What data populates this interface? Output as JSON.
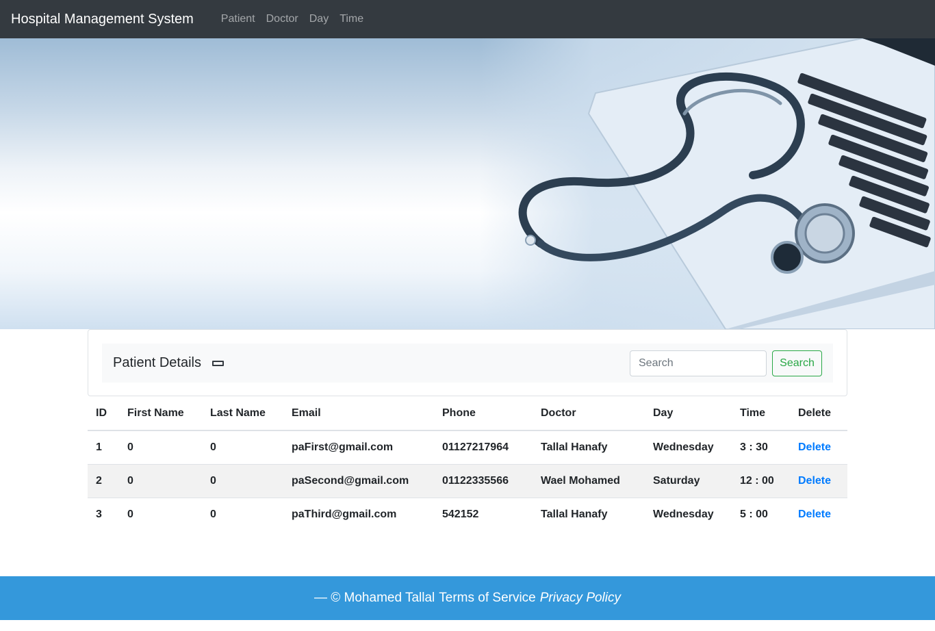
{
  "navbar": {
    "brand": "Hospital Management System",
    "links": [
      "Patient",
      "Doctor",
      "Day",
      "Time"
    ]
  },
  "card": {
    "title": "Patient Details",
    "search_placeholder": "Search",
    "search_button": "Search"
  },
  "table": {
    "headers": [
      "ID",
      "First Name",
      "Last Name",
      "Email",
      "Phone",
      "Doctor",
      "Day",
      "Time",
      "Delete"
    ],
    "rows": [
      {
        "id": "1",
        "first": "0",
        "last": "0",
        "email": "paFirst@gmail.com",
        "phone": "01127217964",
        "doctor": "Tallal Hanafy",
        "day": "Wednesday",
        "time": "3 : 30",
        "action": "Delete"
      },
      {
        "id": "2",
        "first": "0",
        "last": "0",
        "email": "paSecond@gmail.com",
        "phone": "01122335566",
        "doctor": "Wael Mohamed",
        "day": "Saturday",
        "time": "12 : 00",
        "action": "Delete"
      },
      {
        "id": "3",
        "first": "0",
        "last": "0",
        "email": "paThird@gmail.com",
        "phone": "542152",
        "doctor": "Tallal Hanafy",
        "day": "Wednesday",
        "time": "5 : 00",
        "action": "Delete"
      }
    ]
  },
  "footer": {
    "copyright": "— © Mohamed Tallal",
    "terms": "Terms of Service",
    "privacy": "Privacy Policy"
  },
  "colors": {
    "navbar": "#343a40",
    "footer": "#3498db",
    "search_button": "#28a745",
    "link": "#007bff"
  }
}
